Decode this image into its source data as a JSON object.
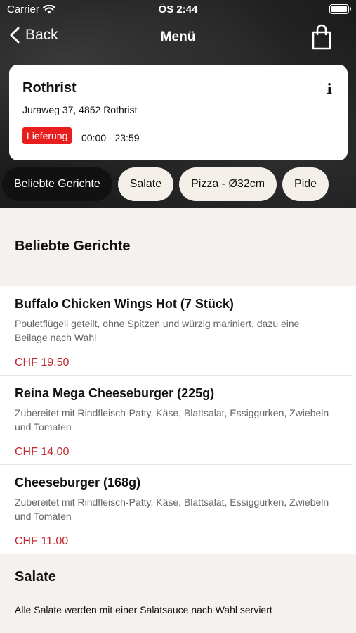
{
  "status_bar": {
    "carrier": "Carrier",
    "time": "ÖS 2:44"
  },
  "nav": {
    "back_label": "Back",
    "title": "Menü"
  },
  "store": {
    "name": "Rothrist",
    "address": "Juraweg 37, 4852 Rothrist",
    "badge": "Lieferung",
    "hours": "00:00 - 23:59",
    "info_glyph": "i"
  },
  "tabs": [
    {
      "label": "Beliebte Gerichte",
      "active": true
    },
    {
      "label": "Salate",
      "active": false
    },
    {
      "label": "Pizza - Ø32cm",
      "active": false
    },
    {
      "label": "Pide",
      "active": false
    }
  ],
  "sections": {
    "popular": {
      "title": "Beliebte Gerichte",
      "items": [
        {
          "name": "Buffalo Chicken Wings Hot (7 Stück)",
          "description": "Pouletflügeli geteilt, ohne Spitzen und würzig mariniert, dazu eine Beilage nach Wahl",
          "price": "CHF 19.50"
        },
        {
          "name": "Reina Mega Cheeseburger (225g)",
          "description": "Zubereitet mit Rindfleisch-Patty, Käse, Blattsalat, Essiggurken, Zwiebeln und Tomaten",
          "price": "CHF 14.00"
        },
        {
          "name": "Cheeseburger (168g)",
          "description": "Zubereitet mit Rindfleisch-Patty, Käse, Blattsalat, Essiggurken, Zwiebeln und Tomaten",
          "price": "CHF 11.00"
        }
      ]
    },
    "salate": {
      "title": "Salate",
      "description": "Alle Salate werden mit einer Salatsauce nach Wahl serviert"
    }
  },
  "colors": {
    "accent": "#c0282d",
    "badge": "#e81e1e",
    "header_bg": "#1c1c1c",
    "page_bg": "#f4f1ee"
  },
  "icons": {
    "wifi": "wifi-icon",
    "battery": "battery-icon",
    "back": "chevron-left-icon",
    "bag": "shopping-bag-icon",
    "info": "info-icon"
  }
}
